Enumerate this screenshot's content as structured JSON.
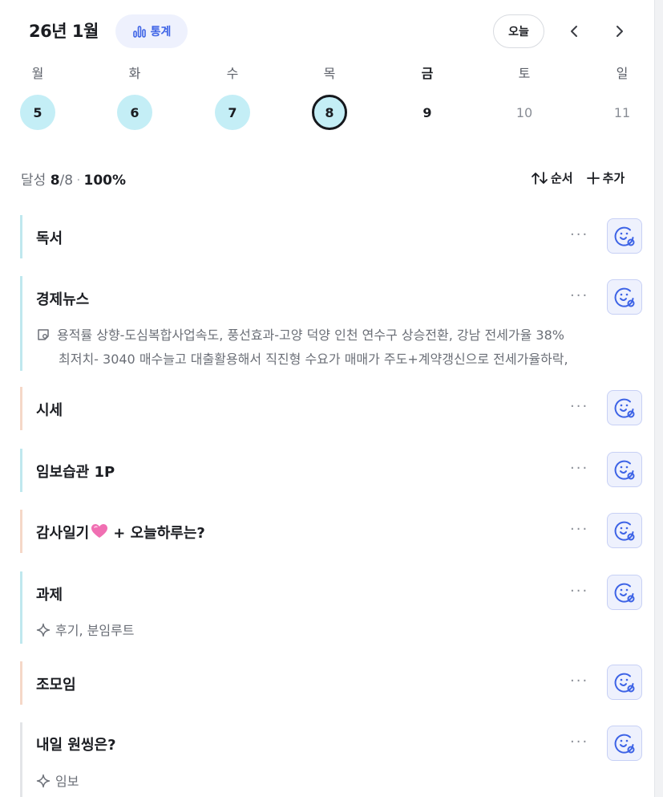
{
  "header": {
    "month_title": "26년 1월",
    "stats_label": "통계",
    "today_label": "오늘",
    "prev_icon": "chevron-left-icon",
    "next_icon": "chevron-right-icon"
  },
  "week": [
    {
      "name": "월",
      "num": "5",
      "state": "done"
    },
    {
      "name": "화",
      "num": "6",
      "state": "done"
    },
    {
      "name": "수",
      "num": "7",
      "state": "done"
    },
    {
      "name": "목",
      "num": "8",
      "state": "selected"
    },
    {
      "name": "금",
      "num": "9",
      "state": "today"
    },
    {
      "name": "토",
      "num": "10",
      "state": "future"
    },
    {
      "name": "일",
      "num": "11",
      "state": "future"
    }
  ],
  "summary": {
    "label": "달성",
    "done": "8",
    "total": "/8",
    "percent": "100%",
    "sort_label": "순서",
    "add_label": "추가"
  },
  "habits": [
    {
      "title": "독서",
      "more": "···"
    },
    {
      "title": "경제뉴스",
      "more": "···",
      "note_line1": "용적률 상향-도심복합사업속도, 풍선효과-고양 덕양 인천 연수구 상승전환, 강남 전세가율 38%",
      "note_line2": "최저치- 3040 매수늘고 대출활용해서 직진형 수요가 매매가 주도+계약갱신으로 전세가율하락,"
    },
    {
      "title": "시세",
      "more": "···"
    },
    {
      "title": "임보습관 1P",
      "more": "···"
    },
    {
      "title_before": "감사일기",
      "title_after": "+ 오늘하루는?",
      "more": "···"
    },
    {
      "title": "과제",
      "more": "···",
      "tag": "후기, 분임루트"
    },
    {
      "title": "조모임",
      "more": "···"
    },
    {
      "title": "내일 원씽은?",
      "more": "···",
      "tag": "임보"
    }
  ],
  "colors": {
    "accent": "#3d63e6",
    "done_circle": "#c4eef6",
    "bar_teal": "#bfe8ee",
    "bar_peach": "#f5d8c8"
  }
}
